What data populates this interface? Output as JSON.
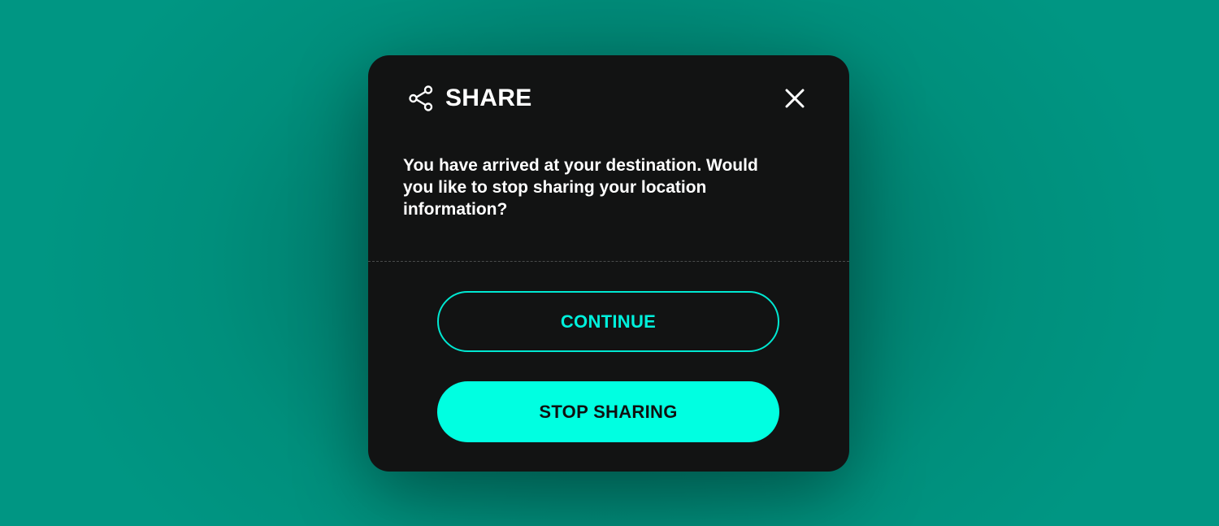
{
  "dialog": {
    "title": "SHARE",
    "title_icon": "share-icon",
    "close_icon": "close-icon",
    "message": "You have arrived at your destination. Would you like to stop sharing your location information?",
    "buttons": {
      "continue_label": "CONTINUE",
      "stop_label": "STOP SHARING"
    }
  },
  "colors": {
    "background": "#009683",
    "dialog_bg": "#121313",
    "accent": "#00ffe1",
    "text": "#ffffff"
  }
}
